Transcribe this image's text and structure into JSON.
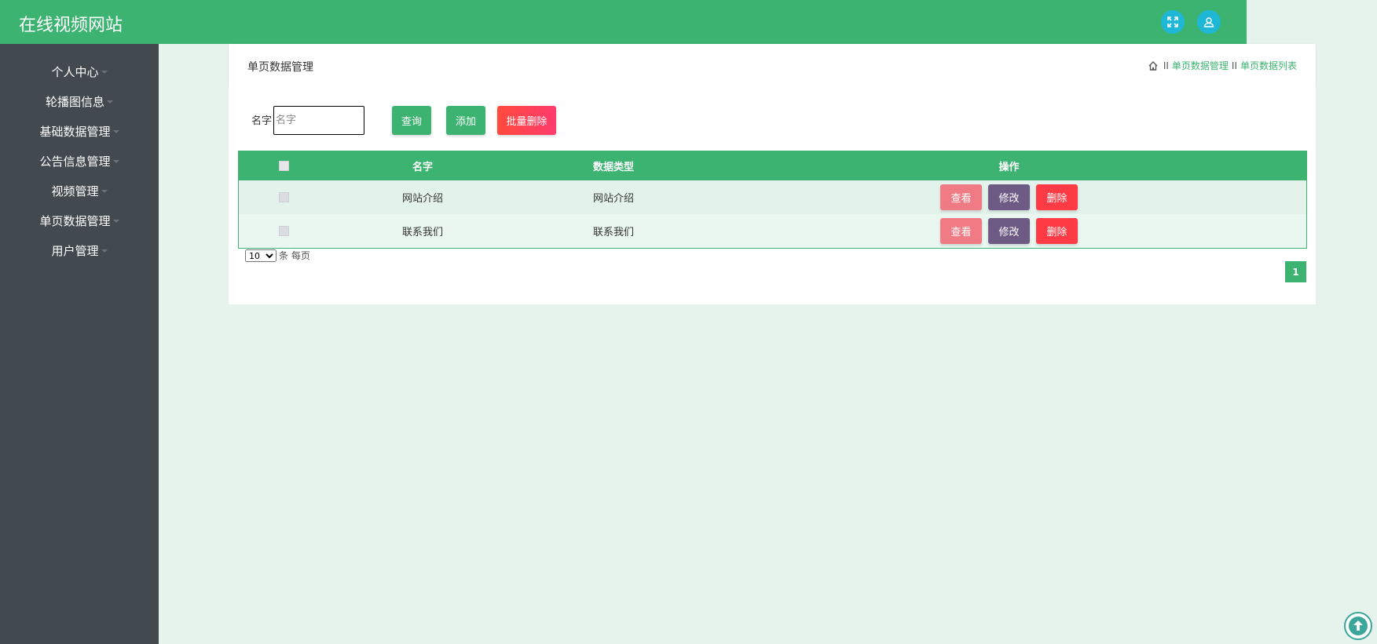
{
  "app": {
    "title": "在线视频网站"
  },
  "topbar": {
    "fullscreen_icon": "fullscreen-icon",
    "user_icon": "user-icon"
  },
  "sidebar": {
    "items": [
      {
        "label": "个人中心"
      },
      {
        "label": "轮播图信息"
      },
      {
        "label": "基础数据管理"
      },
      {
        "label": "公告信息管理"
      },
      {
        "label": "视频管理"
      },
      {
        "label": "单页数据管理"
      },
      {
        "label": "用户管理"
      }
    ]
  },
  "header": {
    "title": "单页数据管理",
    "breadcrumb": {
      "sep": "II",
      "crumb1": "单页数据管理",
      "crumb2": "单页数据列表"
    }
  },
  "search": {
    "label": "名字",
    "placeholder": "名字",
    "value": "",
    "query_label": "查询",
    "add_label": "添加",
    "batch_delete_label": "批量删除"
  },
  "table": {
    "headers": {
      "name": "名字",
      "type": "数据类型",
      "ops": "操作"
    },
    "rows": [
      {
        "name": "网站介绍",
        "type": "网站介绍"
      },
      {
        "name": "联系我们",
        "type": "联系我们"
      }
    ],
    "ops": {
      "view": "查看",
      "edit": "修改",
      "delete": "删除"
    }
  },
  "pagination": {
    "page_size": "10",
    "page_size_suffix": "条 每页",
    "current_page": "1"
  },
  "colors": {
    "primary": "#3cb371",
    "sidebar": "#434a4f",
    "view": "#f07b85",
    "edit": "#6d5a85",
    "delete": "#ff3c46"
  }
}
